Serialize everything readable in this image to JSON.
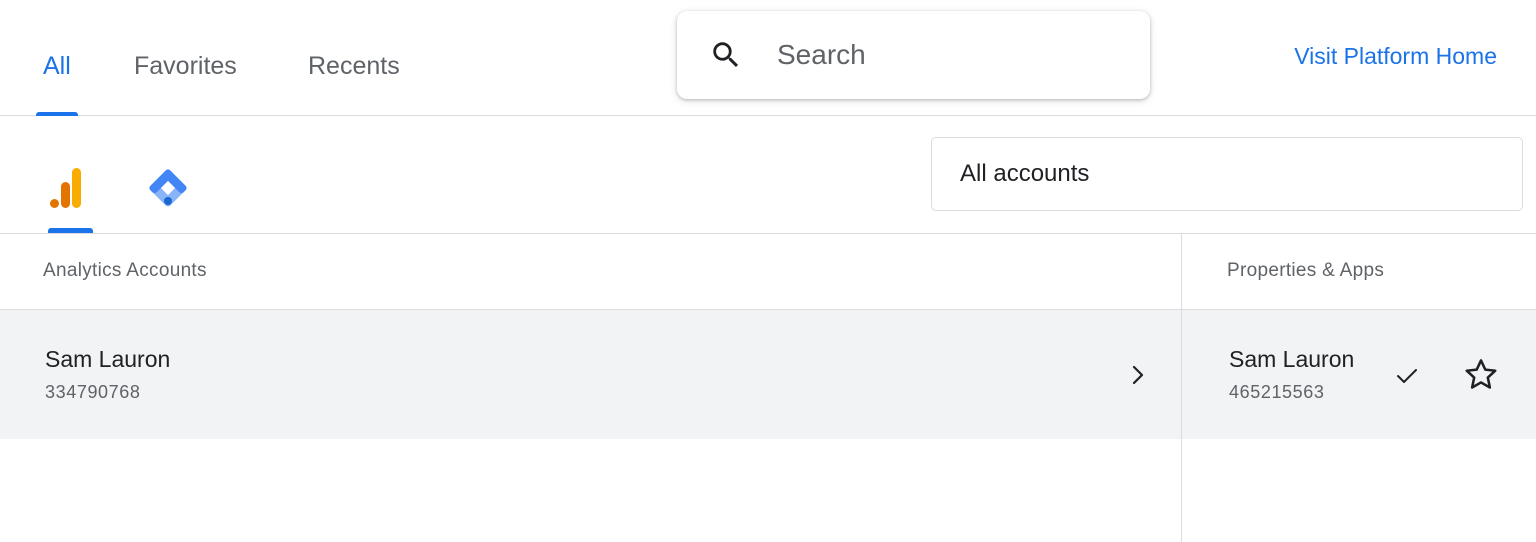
{
  "tabs": [
    {
      "label": "All",
      "active": true
    },
    {
      "label": "Favorites",
      "active": false
    },
    {
      "label": "Recents",
      "active": false
    }
  ],
  "search": {
    "placeholder": "Search",
    "icon": "search-icon"
  },
  "visit_link": "Visit Platform Home",
  "products": [
    {
      "icon": "google-analytics-icon",
      "active": true
    },
    {
      "icon": "google-tag-manager-icon",
      "active": false
    }
  ],
  "account_filter": {
    "selected": "All accounts"
  },
  "columns": {
    "accounts_header": "Analytics Accounts",
    "properties_header": "Properties & Apps"
  },
  "accounts": [
    {
      "name": "Sam Lauron",
      "id": "334790768",
      "icon": "chevron-right-icon"
    }
  ],
  "properties": [
    {
      "name": "Sam Lauron",
      "id": "465215563",
      "selected": true,
      "favorite": false
    }
  ],
  "colors": {
    "accent": "#1a73e8",
    "analytics_orange_dark": "#e37400",
    "analytics_orange_light": "#f9ab00",
    "tagmanager_blue": "#4285f4",
    "tagmanager_light_blue": "#8ab4f8",
    "row_selected_bg": "#f1f3f4"
  }
}
